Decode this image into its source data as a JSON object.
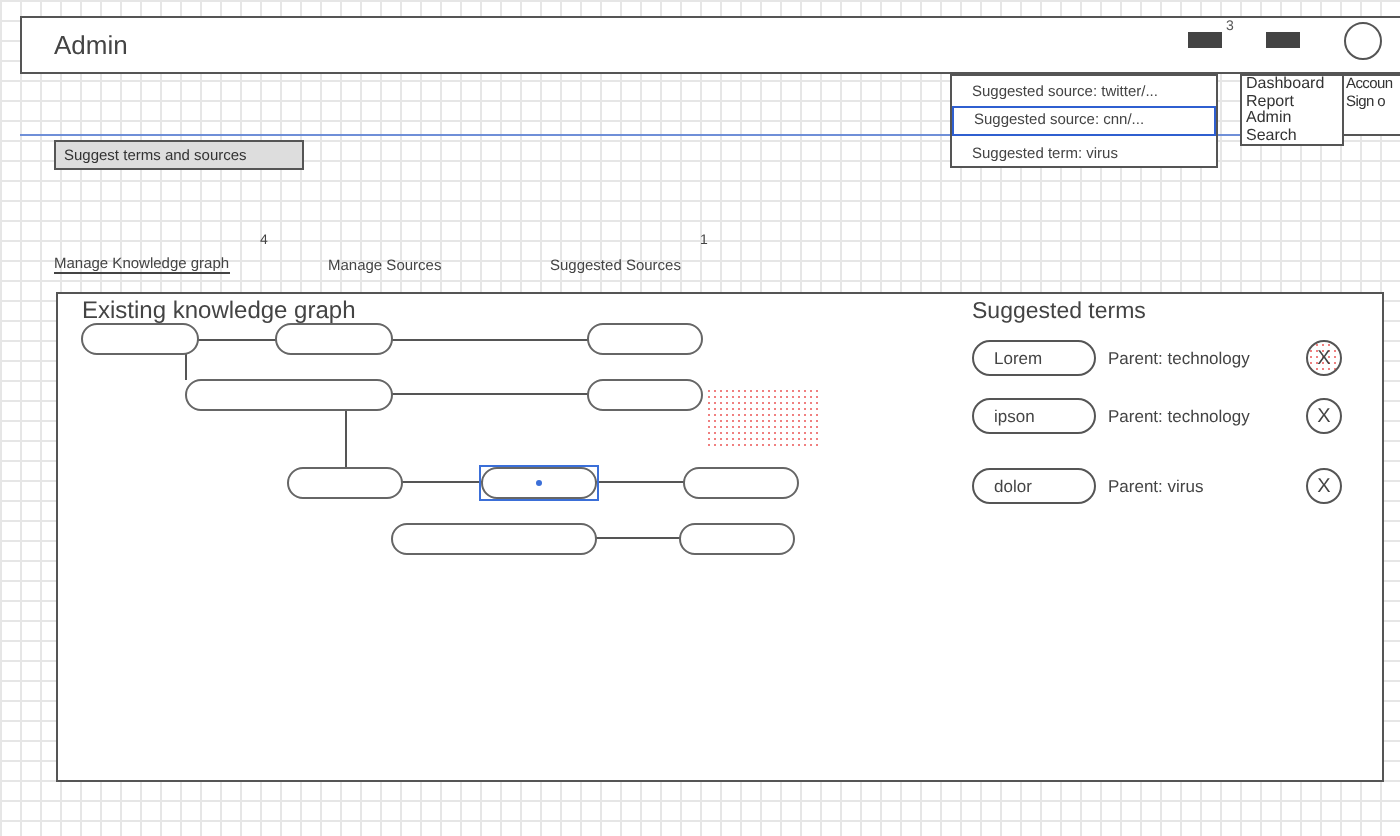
{
  "header": {
    "title": "Admin",
    "notification_count": "3"
  },
  "suggestions_dropdown": [
    {
      "label": "Suggested source: twitter/...",
      "selected": false
    },
    {
      "label": "Suggested source: cnn/...",
      "selected": true
    },
    {
      "label": "Suggested term: virus",
      "selected": false
    }
  ],
  "menu": [
    "Dashboard",
    "Report",
    "Admin",
    "Search"
  ],
  "account_menu": [
    "Accoun",
    "Sign o"
  ],
  "suggest_button": "Suggest terms and sources",
  "tabs": [
    {
      "label": "Manage Knowledge graph",
      "badge": "4",
      "selected": true
    },
    {
      "label": "Manage Sources",
      "selected": false
    },
    {
      "label": "Suggested Sources",
      "badge": "1",
      "selected": false
    }
  ],
  "graph": {
    "title": "Existing knowledge graph",
    "nodes": [
      {
        "selected": false
      },
      {
        "selected": false
      },
      {
        "selected": false
      },
      {
        "selected": false
      },
      {
        "selected": false
      },
      {
        "selected": false
      },
      {
        "selected": true
      },
      {
        "selected": false
      },
      {
        "selected": false
      },
      {
        "selected": false
      }
    ]
  },
  "suggested_terms": {
    "title": "Suggested terms",
    "items": [
      {
        "term": "Lorem",
        "parent": "Parent: technology",
        "remove": "X",
        "highlighted": true
      },
      {
        "term": "ipson",
        "parent": "Parent: technology",
        "remove": "X",
        "highlighted": false
      },
      {
        "term": "dolor",
        "parent": "Parent: virus",
        "remove": "X",
        "highlighted": false
      }
    ]
  }
}
